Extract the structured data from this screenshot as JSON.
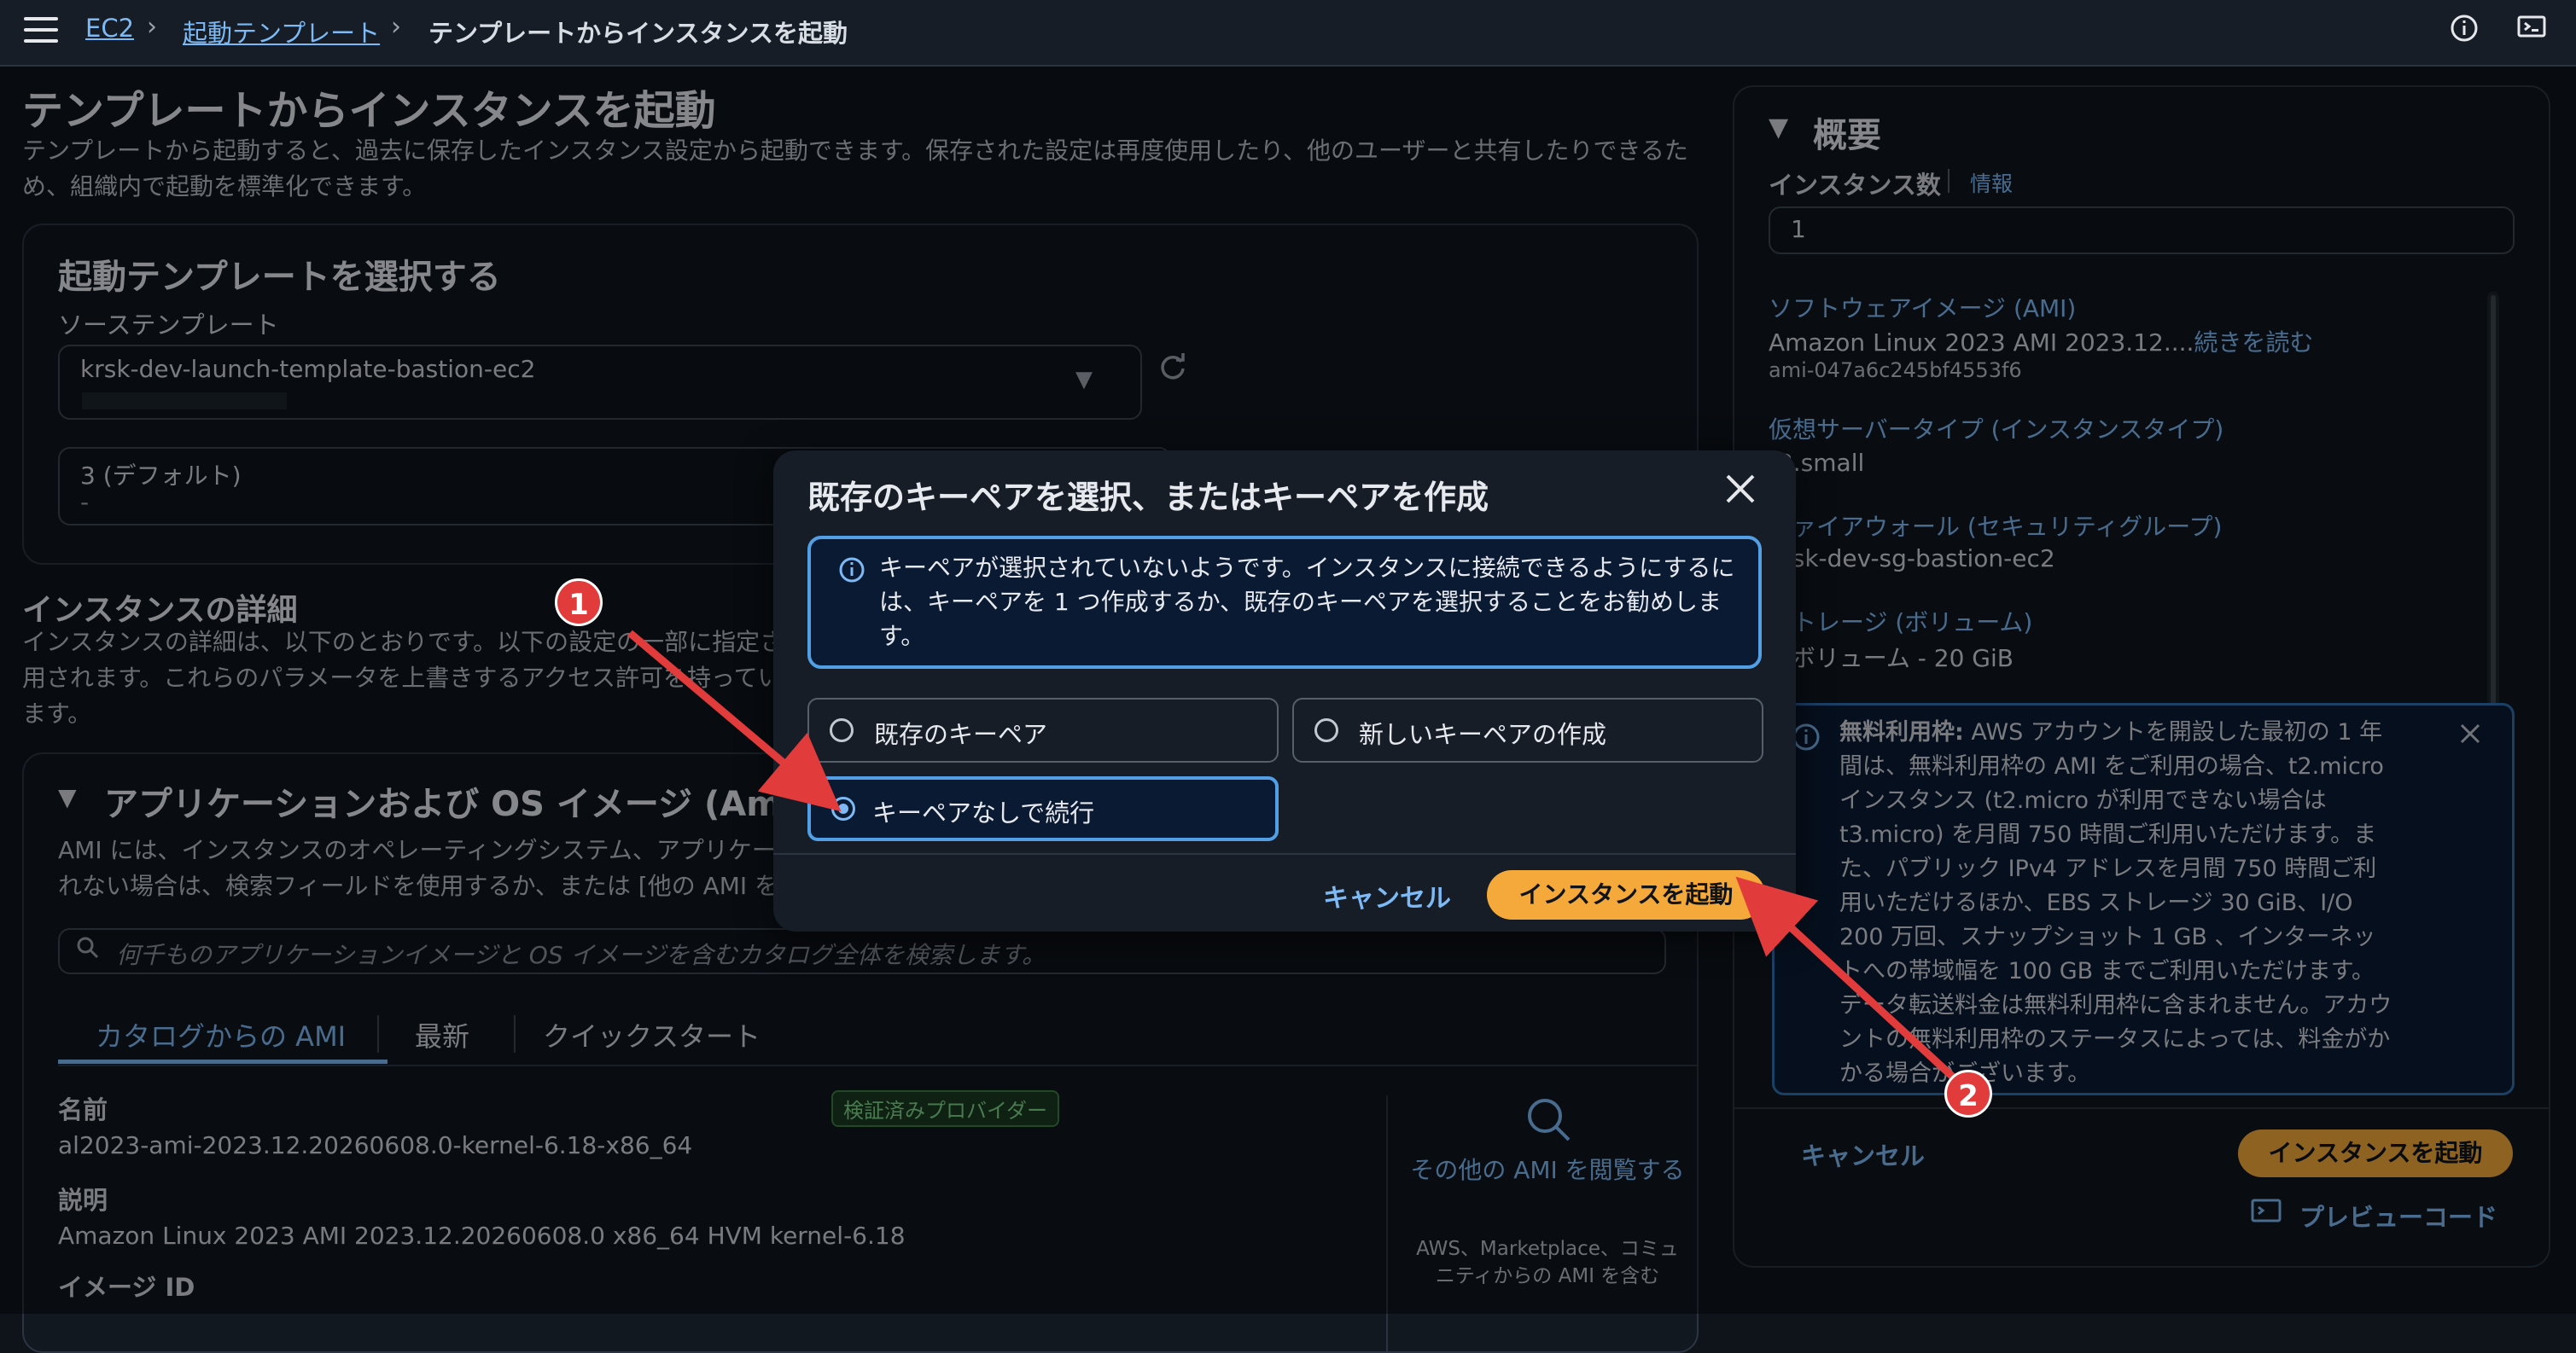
{
  "topbar": {
    "crumb_ec2": "EC2",
    "crumb_templates": "起動テンプレート",
    "crumb_current": "テンプレートからインスタンスを起動"
  },
  "page": {
    "title": "テンプレートからインスタンスを起動",
    "description_1": "テンプレートから起動すると、過去に保存したインスタンス設定から起動できます。保存された設定は再度使用したり、他のユーザーと共有したりできるた",
    "description_2": "め、組織内で起動を標準化できます。"
  },
  "template_panel": {
    "title": "起動テンプレートを選択する",
    "source_label": "ソーステンプレート",
    "source_value": "krsk-dev-launch-template-bastion-ec2",
    "version_value": "3 (デフォルト)",
    "version_sub": "-"
  },
  "details": {
    "title": "インスタンスの詳細",
    "desc_1": "インスタンスの詳細は、以下のとおりです。以下の設定の一部に指定さ",
    "desc_2": "用されます。これらのパラメータを上書きするアクセス許可を持ってい",
    "desc_3": "ます。"
  },
  "ami_panel": {
    "title": "アプリケーションおよび OS イメージ (Amaz",
    "desc_1": "AMI には、インスタンスのオペレーティングシステム、アプリケー",
    "desc_2": "れない場合は、検索フィールドを使用するか、または [他の AMI を",
    "search_placeholder": "何千ものアプリケーションイメージと OS イメージを含むカタログ全体を検索します。",
    "tabs": [
      "カタログからの AMI",
      "最新",
      "クイックスタート"
    ],
    "name_label": "名前",
    "name_value": "al2023-ami-2023.12.20260608.0-kernel-6.18-x86_64",
    "verified_badge": "検証済みプロバイダー",
    "desc_label": "説明",
    "desc_value": "Amazon Linux 2023 AMI 2023.12.20260608.0 x86_64 HVM kernel-6.18",
    "image_id_label": "イメージ ID",
    "browse_more": "その他の AMI を閲覧する",
    "browse_sub": "AWS、Marketplace、コミュニティからの AMI を含む"
  },
  "summary": {
    "title": "概要",
    "instance_count_label": "インスタンス数",
    "info_link": "情報",
    "instance_count_value": "1",
    "ami_label": "ソフトウェアイメージ (AMI)",
    "ami_value": "Amazon Linux 2023 AMI 2023.12....",
    "read_more": "続きを読む",
    "ami_id": "ami-047a6c245bf4553f6",
    "type_label": "仮想サーバータイプ (インスタンスタイプ)",
    "type_value": "t3.small",
    "fw_label": "ファイアウォール (セキュリティグループ)",
    "fw_value": "krsk-dev-sg-bastion-ec2",
    "storage_label": "ストレージ (ボリューム)",
    "storage_value": "1 ボリューム - 20 GiB",
    "free_tier_bold": "無料利用枠:",
    "free_tier_text": " AWS アカウントを開設した最初の 1 年間は、無料利用枠の AMI をご利用の場合、t2.micro インスタンス (t2.micro が利用できない場合は t3.micro) を月間 750 時間ご利用いただけます。また、パブリック IPv4 アドレスを月間 750 時間ご利用いただけるほか、EBS ストレージ 30 GiB、I/O 200 万回、スナップショット 1 GB 、インターネットへの帯域幅を 100 GB までご利用いただけます。データ転送料金は無料利用枠に含まれません。アカウントの無料利用枠のステータスによっては、料金がかかる場合がございます。",
    "cancel": "キャンセル",
    "launch": "インスタンスを起動",
    "preview_code": "プレビューコード"
  },
  "modal": {
    "title": "既存のキーペアを選択、またはキーペアを作成",
    "info": "キーペアが選択されていないようです。インスタンスに接続できるようにするには、キーペアを 1 つ作成するか、既存のキーペアを選択することをお勧めします。",
    "option_existing": "既存のキーペア",
    "option_new": "新しいキーペアの作成",
    "option_none": "キーペアなしで続行",
    "cancel": "キャンセル",
    "launch": "インスタンスを起動"
  },
  "annotations": {
    "step1": "1",
    "step2": "2",
    "arrow_color": "#e23b3b"
  }
}
